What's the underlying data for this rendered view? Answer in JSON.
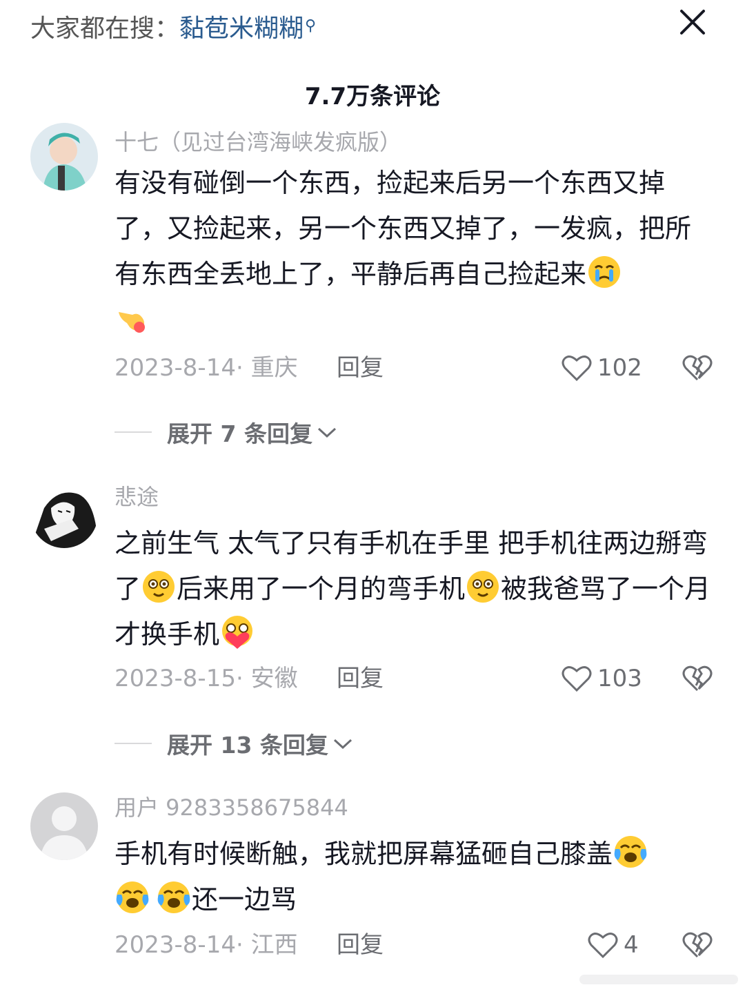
{
  "header": {
    "search_prefix": "大家都在搜：",
    "search_keyword": "黏苞米糊糊",
    "title": "7.7万条评论"
  },
  "comments": [
    {
      "username": "十七（见过台湾海峡发疯版）",
      "text_parts": [
        "有没有碰倒一个东西，捡起来后另一个东西又掉了，又捡起来，另一个东西又掉了，一发疯，把所有东西全丢地上了，平静后再自己捡起来"
      ],
      "emojis": [
        "crying-face",
        "pointing-hand"
      ],
      "meta": "2023-8-14· 重庆",
      "reply_label": "回复",
      "likes": "102",
      "expand_label": "展开 7 条回复"
    },
    {
      "username": "悲途",
      "text_parts": [
        "之前生气 太气了只有手机在手里 把手机往两边掰弯了",
        "后来用了一个月的弯手机",
        "被我爸骂了一个月才换手机"
      ],
      "emojis": [
        "flushed-face",
        "flushed-face",
        "pleading-heart-face"
      ],
      "meta": "2023-8-15· 安徽",
      "reply_label": "回复",
      "likes": "103",
      "expand_label": "展开 13 条回复"
    },
    {
      "username": "用户 9283358675844",
      "text_parts": [
        "手机有时候断触，我就把屏幕猛砸自己膝盖",
        "还一边骂"
      ],
      "emojis": [
        "crying-laughing-face",
        "crying-laughing-face",
        "crying-laughing-face"
      ],
      "meta": "2023-8-14· 江西",
      "reply_label": "回复",
      "likes": "4"
    }
  ],
  "colors": {
    "keyword": "#2a5b8f",
    "muted": "#a7a8ad",
    "text": "#161823"
  }
}
